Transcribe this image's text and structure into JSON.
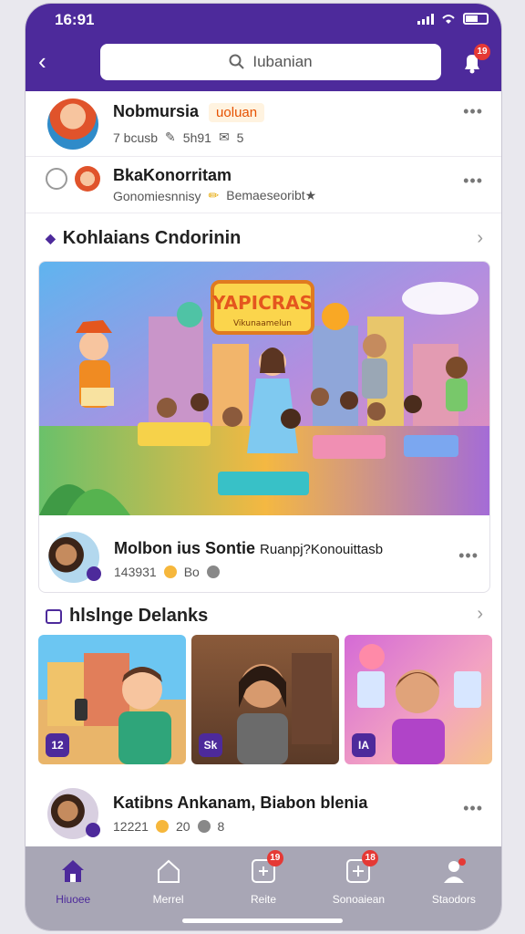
{
  "status": {
    "time": "16:91"
  },
  "search": {
    "query": "Iubanian"
  },
  "notifications": {
    "badge": "19"
  },
  "feed": [
    {
      "name": "Nobmursia",
      "tag": "uoluan",
      "stats": [
        "7 bcusb",
        "5h91",
        "5"
      ]
    },
    {
      "name": "BkaKonorritam",
      "subtitle": "Gonomiesnnisy",
      "extra": "Bemaeseoribt★"
    }
  ],
  "featured": {
    "section_title": "Kohlaians Cndorinin",
    "banner_title": "YAPICRAS",
    "banner_subtitle": "Vikunaamelun",
    "author": "Molbon ius Sontie",
    "caption": "Ruanpj?Konouittasb",
    "views": "143931",
    "likes": "Bo"
  },
  "highlights": {
    "section_title": "hlslnge Delanks",
    "thumbs": [
      {
        "badge": "12"
      },
      {
        "badge": "Sk"
      },
      {
        "badge": "IA"
      }
    ]
  },
  "last_post": {
    "name": "Katibns Ankanam, Biabon blenia",
    "views": "12221",
    "likes": "20",
    "replies": "8"
  },
  "nav": [
    {
      "label": "Hiuoee",
      "badge": ""
    },
    {
      "label": "Merrel",
      "badge": ""
    },
    {
      "label": "Reite",
      "badge": "19"
    },
    {
      "label": "Sonoaiean",
      "badge": "18"
    },
    {
      "label": "Staodors",
      "badge": ""
    }
  ],
  "colors": {
    "brand": "#4d2a9b",
    "badge": "#e53935",
    "nav_bg": "#a8a6b5"
  }
}
